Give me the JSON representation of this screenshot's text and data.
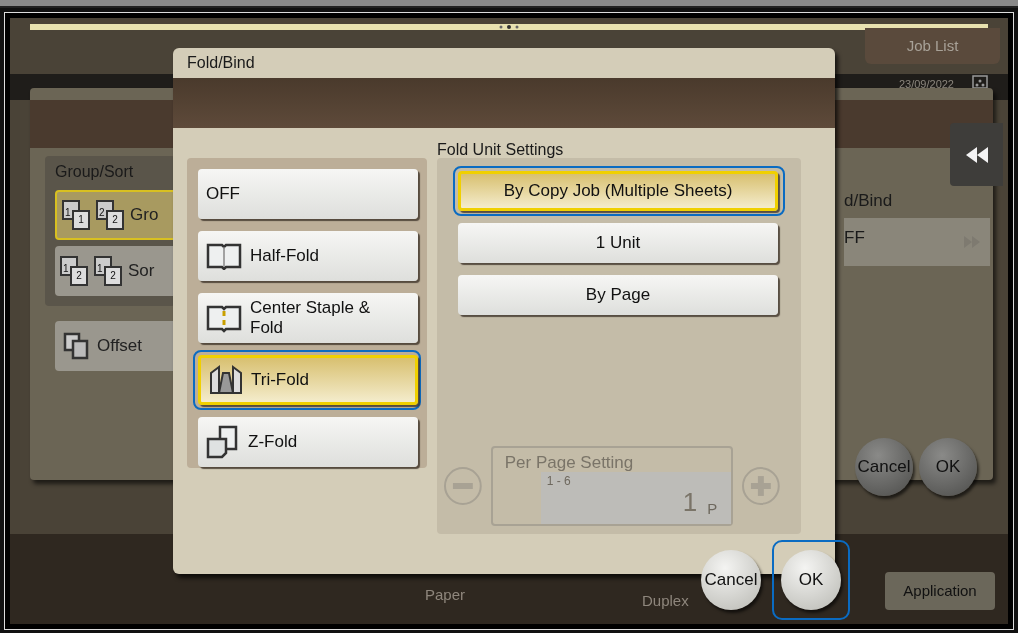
{
  "job_list_button": "Job List",
  "status_bar": {
    "date": "23/09/2022"
  },
  "background_panel": {
    "group_sort": {
      "label": "Group/Sort",
      "options": [
        {
          "label": "Gro",
          "selected": true,
          "pages": [
            [
              "1",
              "1"
            ],
            [
              "2",
              "2"
            ]
          ]
        },
        {
          "label": "Sor",
          "selected": false,
          "pages": [
            [
              "1",
              "2"
            ],
            [
              "1",
              "2"
            ]
          ]
        }
      ]
    },
    "offset_button": "Offset",
    "setting_label": "d/Bind",
    "setting_value": "FF",
    "buttons": [
      "Cancel",
      "OK"
    ]
  },
  "bottom_bar": {
    "paper": "Paper",
    "duplex": "Duplex",
    "application_button": "Application"
  },
  "dialog": {
    "title": "Fold/Bind",
    "fold_options": [
      {
        "label": "OFF",
        "kind": "plain",
        "selected": false,
        "focused": false
      },
      {
        "label": "Half-Fold",
        "kind": "book",
        "selected": false,
        "focused": false
      },
      {
        "label": "Center Staple & Fold",
        "kind": "staple-book",
        "selected": false,
        "focused": false
      },
      {
        "label": "Tri-Fold",
        "kind": "trifold",
        "selected": true,
        "focused": true
      },
      {
        "label": "Z-Fold",
        "kind": "zfold",
        "selected": false,
        "focused": false
      }
    ],
    "unit_settings": {
      "label": "Fold Unit Settings",
      "options": [
        {
          "label": "By Copy Job (Multiple Sheets)",
          "selected": true,
          "focused": true
        },
        {
          "label": "1 Unit",
          "selected": false,
          "focused": false
        },
        {
          "label": "By Page",
          "selected": false,
          "focused": false
        }
      ]
    },
    "per_page": {
      "label": "Per Page Setting",
      "range": "1 - 6",
      "value": "1",
      "unit": "P",
      "disabled": true
    },
    "buttons": [
      {
        "label": "Cancel",
        "focused": false
      },
      {
        "label": "OK",
        "focused": true
      }
    ]
  }
}
